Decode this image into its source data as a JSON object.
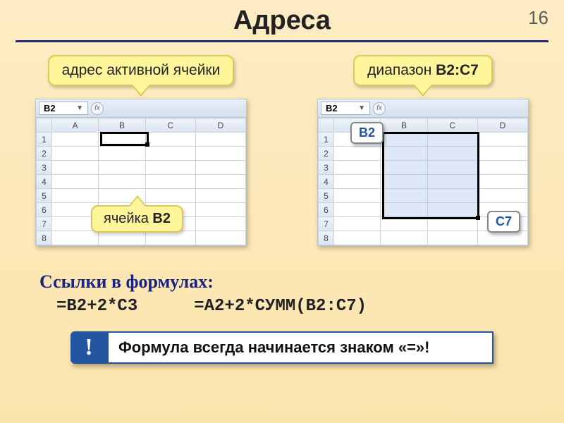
{
  "page_number": "16",
  "title": "Адреса",
  "left": {
    "callout": "адрес активной ячейки",
    "namebox": "B2",
    "columns": [
      "A",
      "B",
      "C",
      "D"
    ],
    "rows": [
      "1",
      "2",
      "3",
      "4",
      "5",
      "6",
      "7",
      "8"
    ],
    "cell_callout_prefix": "ячейка ",
    "cell_callout_bold": "B2"
  },
  "right": {
    "callout_prefix": "диапазон ",
    "callout_bold": "B2:C7",
    "namebox": "B2",
    "columns": [
      "A",
      "B",
      "C",
      "D"
    ],
    "rows": [
      "1",
      "2",
      "3",
      "4",
      "5",
      "6",
      "7",
      "8"
    ],
    "tag_top": "B2",
    "tag_bottom": "C7"
  },
  "subheading": "Ссылки в формулах:",
  "formula1": "=B2+2*C3",
  "formula2": "=A2+2*СУММ(B2:C7)",
  "notice": {
    "bang": "!",
    "text": "Формула всегда начинается знаком «=»!"
  }
}
